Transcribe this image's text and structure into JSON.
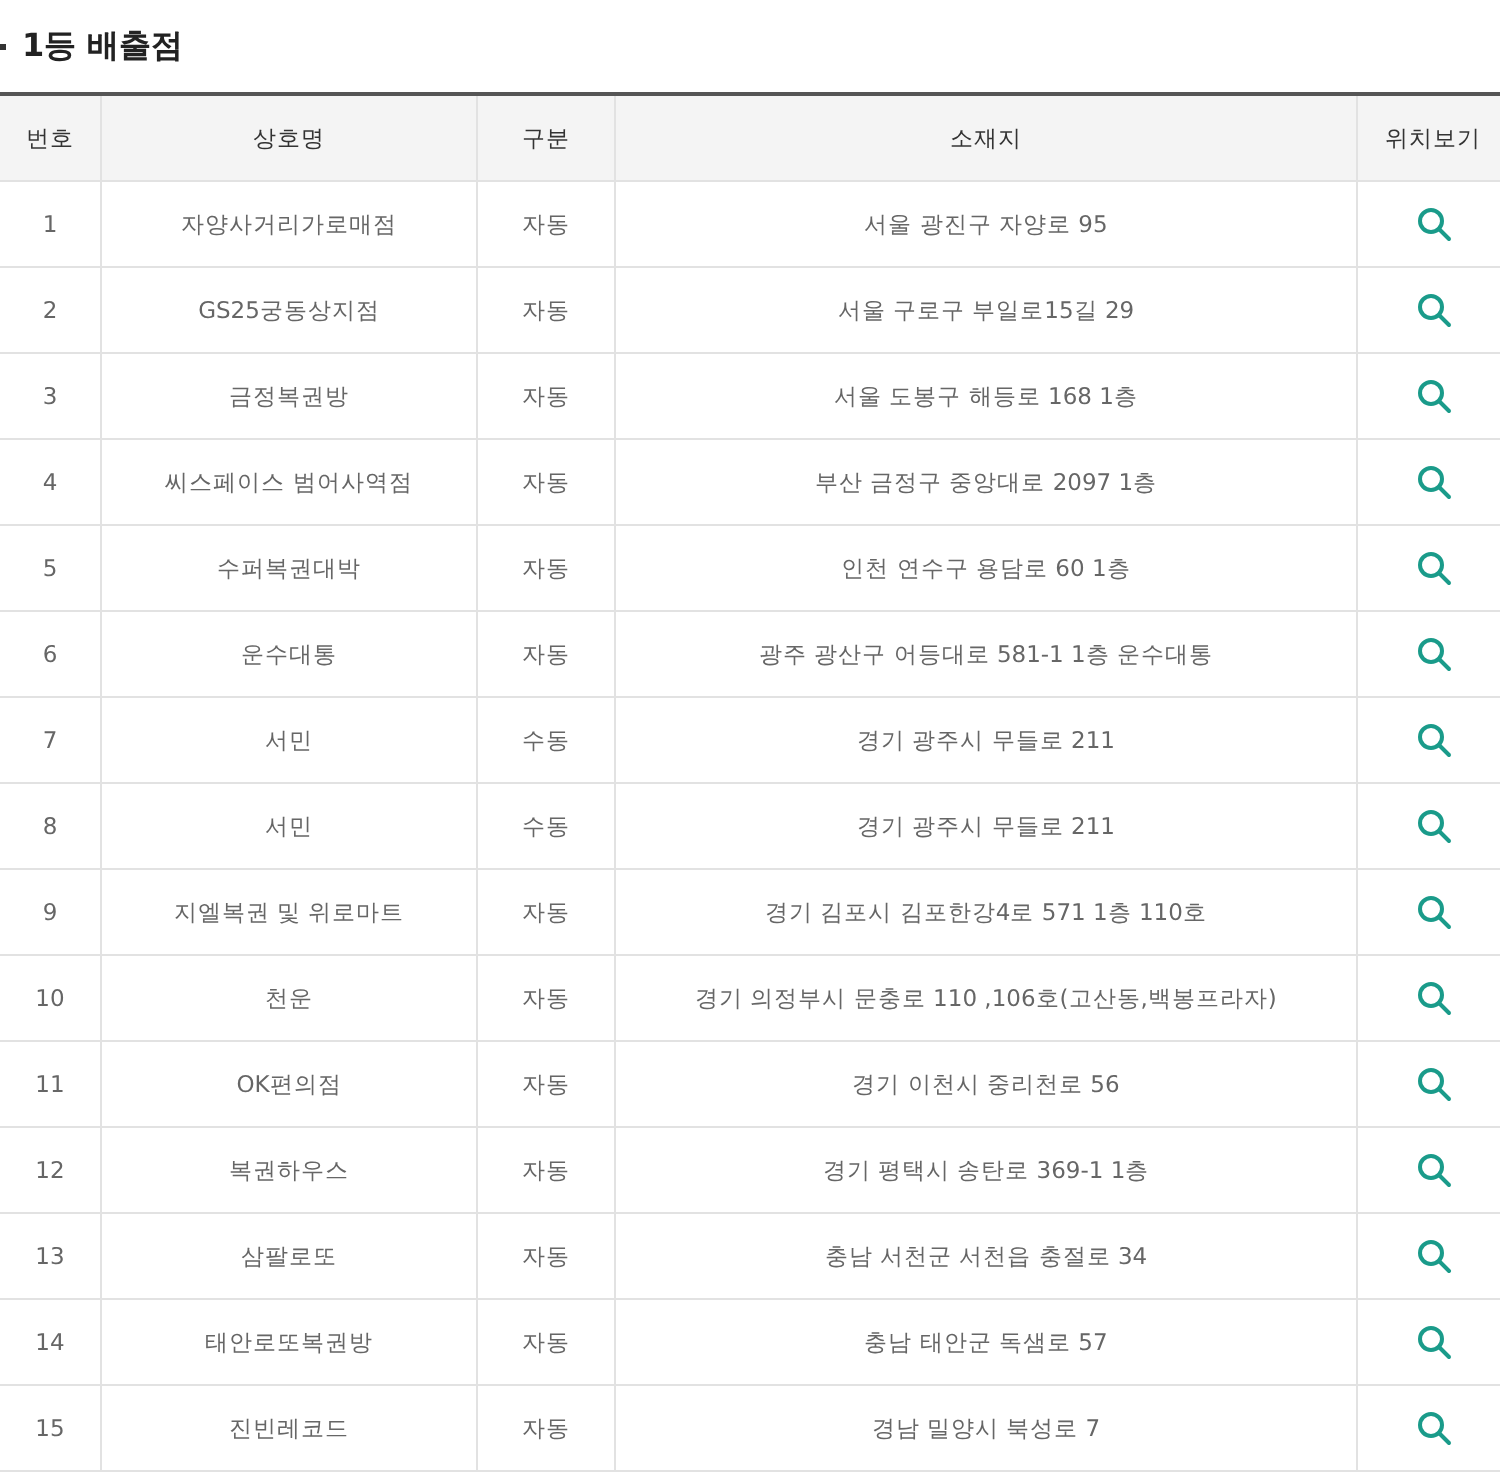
{
  "title": "1등 배출점",
  "table": {
    "columns": [
      "번호",
      "상호명",
      "구분",
      "소재지",
      "위치보기"
    ],
    "rows": [
      {
        "no": "1",
        "name": "자양사거리가로매점",
        "type": "자동",
        "address": "서울 광진구 자양로 95"
      },
      {
        "no": "2",
        "name": "GS25궁동상지점",
        "type": "자동",
        "address": "서울 구로구 부일로15길 29"
      },
      {
        "no": "3",
        "name": "금정복권방",
        "type": "자동",
        "address": "서울 도봉구 해등로 168 1층"
      },
      {
        "no": "4",
        "name": "씨스페이스 범어사역점",
        "type": "자동",
        "address": "부산 금정구 중앙대로 2097 1층"
      },
      {
        "no": "5",
        "name": "수퍼복권대박",
        "type": "자동",
        "address": "인천 연수구 용담로 60 1층"
      },
      {
        "no": "6",
        "name": "운수대통",
        "type": "자동",
        "address": "광주 광산구 어등대로 581-1 1층 운수대통"
      },
      {
        "no": "7",
        "name": "서민",
        "type": "수동",
        "address": "경기 광주시 무들로 211"
      },
      {
        "no": "8",
        "name": "서민",
        "type": "수동",
        "address": "경기 광주시 무들로 211"
      },
      {
        "no": "9",
        "name": "지엘복권 및 위로마트",
        "type": "자동",
        "address": "경기 김포시 김포한강4로 571 1층 110호"
      },
      {
        "no": "10",
        "name": "천운",
        "type": "자동",
        "address": "경기 의정부시 문충로 110 ,106호(고산동,백봉프라자)"
      },
      {
        "no": "11",
        "name": "OK편의점",
        "type": "자동",
        "address": "경기 이천시 중리천로 56"
      },
      {
        "no": "12",
        "name": "복권하우스",
        "type": "자동",
        "address": "경기 평택시 송탄로 369-1 1층"
      },
      {
        "no": "13",
        "name": "삼팔로또",
        "type": "자동",
        "address": "충남 서천군 서천읍 충절로 34"
      },
      {
        "no": "14",
        "name": "태안로또복권방",
        "type": "자동",
        "address": "충남 태안군 독샘로 57"
      },
      {
        "no": "15",
        "name": "진빈레코드",
        "type": "자동",
        "address": "경남 밀양시 북성로 7"
      }
    ]
  }
}
